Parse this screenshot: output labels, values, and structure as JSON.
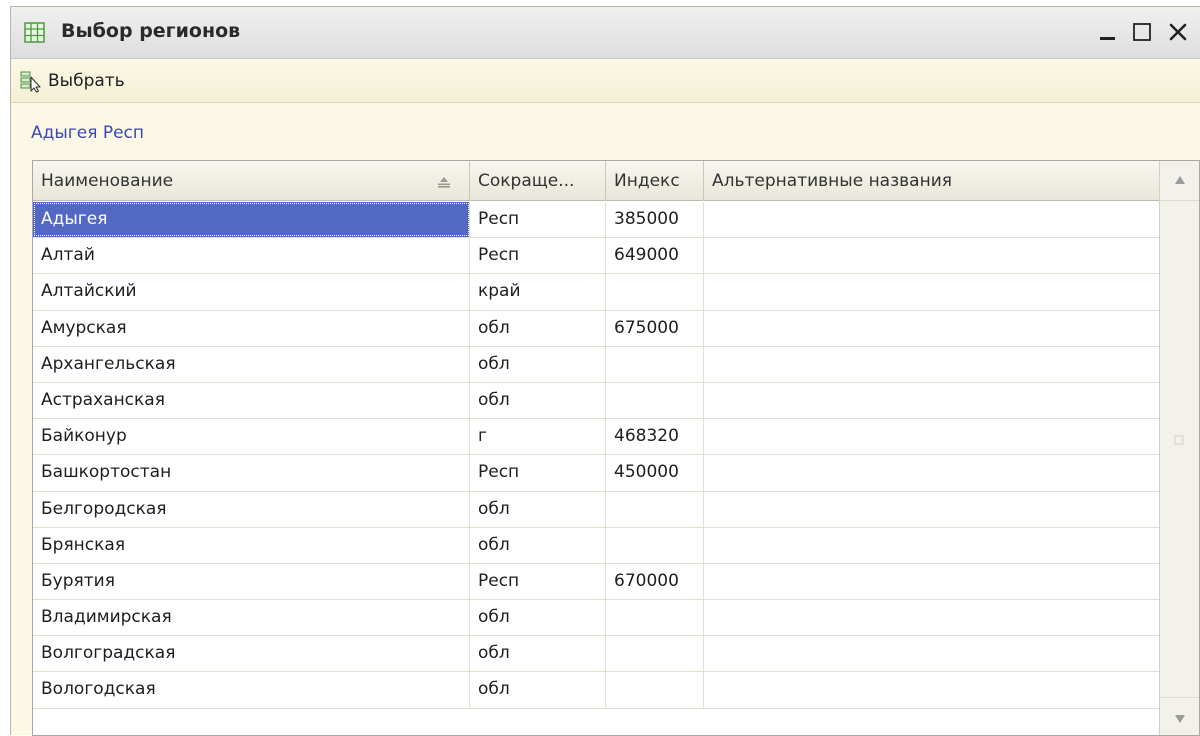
{
  "window": {
    "title": "Выбор регионов",
    "icon": "table-icon"
  },
  "toolbar": {
    "select_label": "Выбрать",
    "select_icon": "select-cursor-icon"
  },
  "current_value": "Адыгея Респ",
  "table": {
    "columns": [
      {
        "label": "Наименование",
        "sorted": "ascending"
      },
      {
        "label": "Сокраще..."
      },
      {
        "label": "Индекс"
      },
      {
        "label": "Альтернативные названия"
      }
    ],
    "rows": [
      {
        "name": "Адыгея",
        "abbr": "Респ",
        "index": "385000",
        "alt": "",
        "selected": true
      },
      {
        "name": "Алтай",
        "abbr": "Респ",
        "index": "649000",
        "alt": ""
      },
      {
        "name": "Алтайский",
        "abbr": "край",
        "index": "",
        "alt": ""
      },
      {
        "name": "Амурская",
        "abbr": "обл",
        "index": "675000",
        "alt": ""
      },
      {
        "name": "Архангельская",
        "abbr": "обл",
        "index": "",
        "alt": ""
      },
      {
        "name": "Астраханская",
        "abbr": "обл",
        "index": "",
        "alt": ""
      },
      {
        "name": "Байконур",
        "abbr": "г",
        "index": "468320",
        "alt": ""
      },
      {
        "name": "Башкортостан",
        "abbr": "Респ",
        "index": "450000",
        "alt": ""
      },
      {
        "name": "Белгородская",
        "abbr": "обл",
        "index": "",
        "alt": ""
      },
      {
        "name": "Брянская",
        "abbr": "обл",
        "index": "",
        "alt": ""
      },
      {
        "name": "Бурятия",
        "abbr": "Респ",
        "index": "670000",
        "alt": ""
      },
      {
        "name": "Владимирская",
        "abbr": "обл",
        "index": "",
        "alt": ""
      },
      {
        "name": "Волгоградская",
        "abbr": "обл",
        "index": "",
        "alt": ""
      },
      {
        "name": "Вологодская",
        "abbr": "обл",
        "index": "",
        "alt": ""
      }
    ]
  },
  "colors": {
    "selection": "#5368c3",
    "link_text": "#3b48b5",
    "form_background": "#fbf8e6"
  }
}
